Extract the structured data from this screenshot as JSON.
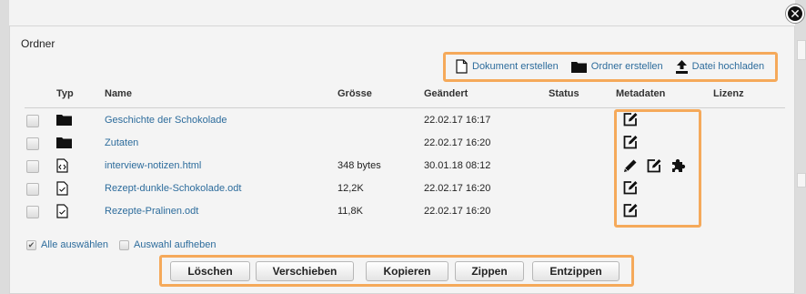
{
  "dialog": {
    "title": "Ordner",
    "close_label": "✕"
  },
  "toolbar": {
    "create_document": "Dokument erstellen",
    "create_folder": "Ordner erstellen",
    "upload_file": "Datei hochladen"
  },
  "table": {
    "headers": {
      "type": "Typ",
      "name": "Name",
      "size": "Grösse",
      "modified": "Geändert",
      "status": "Status",
      "metadata": "Metadaten",
      "license": "Lizenz"
    },
    "rows": [
      {
        "type": "folder",
        "name": "Geschichte der Schokolade",
        "size": "",
        "modified": "22.02.17 16:17",
        "metadata_icons": [
          "edit-icon"
        ]
      },
      {
        "type": "folder",
        "name": "Zutaten",
        "size": "",
        "modified": "22.02.17 16:20",
        "metadata_icons": [
          "edit-icon"
        ]
      },
      {
        "type": "html-file",
        "name": "interview-notizen.html",
        "size": "348 bytes",
        "modified": "30.01.18 08:12",
        "metadata_icons": [
          "pencil-icon",
          "edit-icon",
          "puzzle-icon"
        ]
      },
      {
        "type": "document-file",
        "name": "Rezept-dunkle-Schokolade.odt",
        "size": "12,2K",
        "modified": "22.02.17 16:20",
        "metadata_icons": [
          "edit-icon"
        ]
      },
      {
        "type": "document-file",
        "name": "Rezepte-Pralinen.odt",
        "size": "11,8K",
        "modified": "22.02.17 16:20",
        "metadata_icons": [
          "edit-icon"
        ]
      }
    ]
  },
  "selection": {
    "select_all": "Alle auswählen",
    "deselect": "Auswahl aufheben"
  },
  "actions": {
    "delete": "Löschen",
    "move": "Verschieben",
    "copy": "Kopieren",
    "zip": "Zippen",
    "unzip": "Entzippen"
  },
  "colors": {
    "link": "#2d6c9c",
    "highlight": "#f5a95a"
  }
}
